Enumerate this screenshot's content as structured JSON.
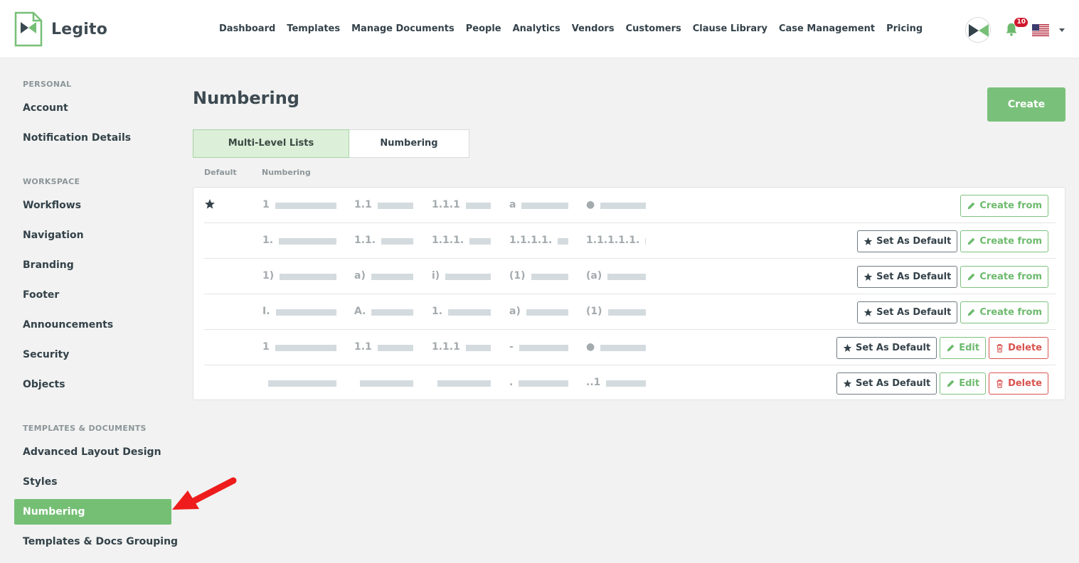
{
  "brand": {
    "name": "Legito"
  },
  "nav": [
    "Dashboard",
    "Templates",
    "Manage Documents",
    "People",
    "Analytics",
    "Vendors",
    "Customers",
    "Clause Library",
    "Case Management",
    "Pricing"
  ],
  "header": {
    "notification_count": "10",
    "locale_flag": "us-flag-icon",
    "avatar": "legito-avatar-icon"
  },
  "sidebar": {
    "sections": [
      {
        "title": "PERSONAL",
        "items": [
          "Account",
          "Notification Details"
        ]
      },
      {
        "title": "WORKSPACE",
        "items": [
          "Workflows",
          "Navigation",
          "Branding",
          "Footer",
          "Announcements",
          "Security",
          "Objects"
        ]
      },
      {
        "title": "TEMPLATES & DOCUMENTS",
        "items": [
          "Advanced Layout Design",
          "Styles",
          "Numbering",
          "Templates & Docs Grouping"
        ]
      }
    ],
    "active_item": "Numbering"
  },
  "main": {
    "title": "Numbering",
    "create_label": "Create",
    "tabs": [
      "Multi-Level Lists",
      "Numbering"
    ],
    "active_tab": "Multi-Level Lists",
    "columns": {
      "default": "Default",
      "numbering": "Numbering"
    },
    "lists": [
      {
        "is_default": true,
        "levels": [
          "1",
          "1.1",
          "1.1.1",
          "a",
          "●"
        ],
        "actions": [
          "create_from"
        ]
      },
      {
        "is_default": false,
        "levels": [
          "1.",
          "1.1.",
          "1.1.1.",
          "1.1.1.1.",
          "1.1.1.1.1."
        ],
        "actions": [
          "set_default",
          "create_from"
        ]
      },
      {
        "is_default": false,
        "levels": [
          "1)",
          "a)",
          "i)",
          "(1)",
          "(a)"
        ],
        "actions": [
          "set_default",
          "create_from"
        ]
      },
      {
        "is_default": false,
        "levels": [
          "I.",
          "A.",
          "1.",
          "a)",
          "(1)"
        ],
        "actions": [
          "set_default",
          "create_from"
        ]
      },
      {
        "is_default": false,
        "levels": [
          "1",
          "1.1",
          "1.1.1",
          "-",
          "●"
        ],
        "actions": [
          "set_default",
          "edit",
          "delete"
        ]
      },
      {
        "is_default": false,
        "levels": [
          "",
          "",
          "",
          ".",
          "..1"
        ],
        "actions": [
          "set_default",
          "edit",
          "delete"
        ]
      }
    ],
    "action_labels": {
      "set_default": "Set As Default",
      "create_from": "Create from",
      "edit": "Edit",
      "delete": "Delete"
    }
  },
  "colors": {
    "accent_green": "#75bf75",
    "danger_red": "#d9534f",
    "annotation_arrow": "#ee1c1c"
  }
}
